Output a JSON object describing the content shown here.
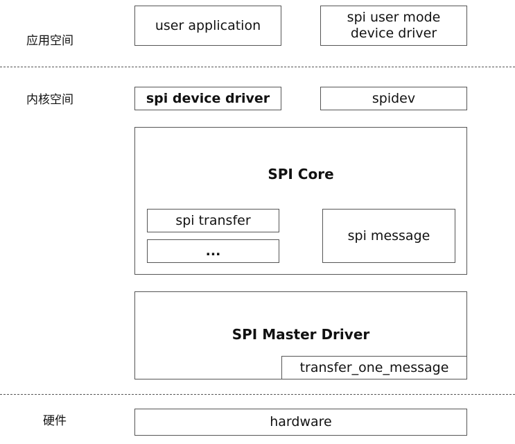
{
  "labels": {
    "user_space": "应用空间",
    "kernel_space": "内核空间",
    "hardware_layer": "硬件"
  },
  "boxes": {
    "user_application": "user application",
    "spi_user_mode": "spi user mode device driver",
    "spi_device_driver": "spi device driver",
    "spidev": "spidev",
    "spi_core": "SPI Core",
    "spi_transfer": "spi transfer",
    "ellipsis": "...",
    "spi_message": "spi message",
    "spi_master_driver": "SPI Master Driver",
    "transfer_one_message": "transfer_one_message",
    "hardware": "hardware"
  }
}
